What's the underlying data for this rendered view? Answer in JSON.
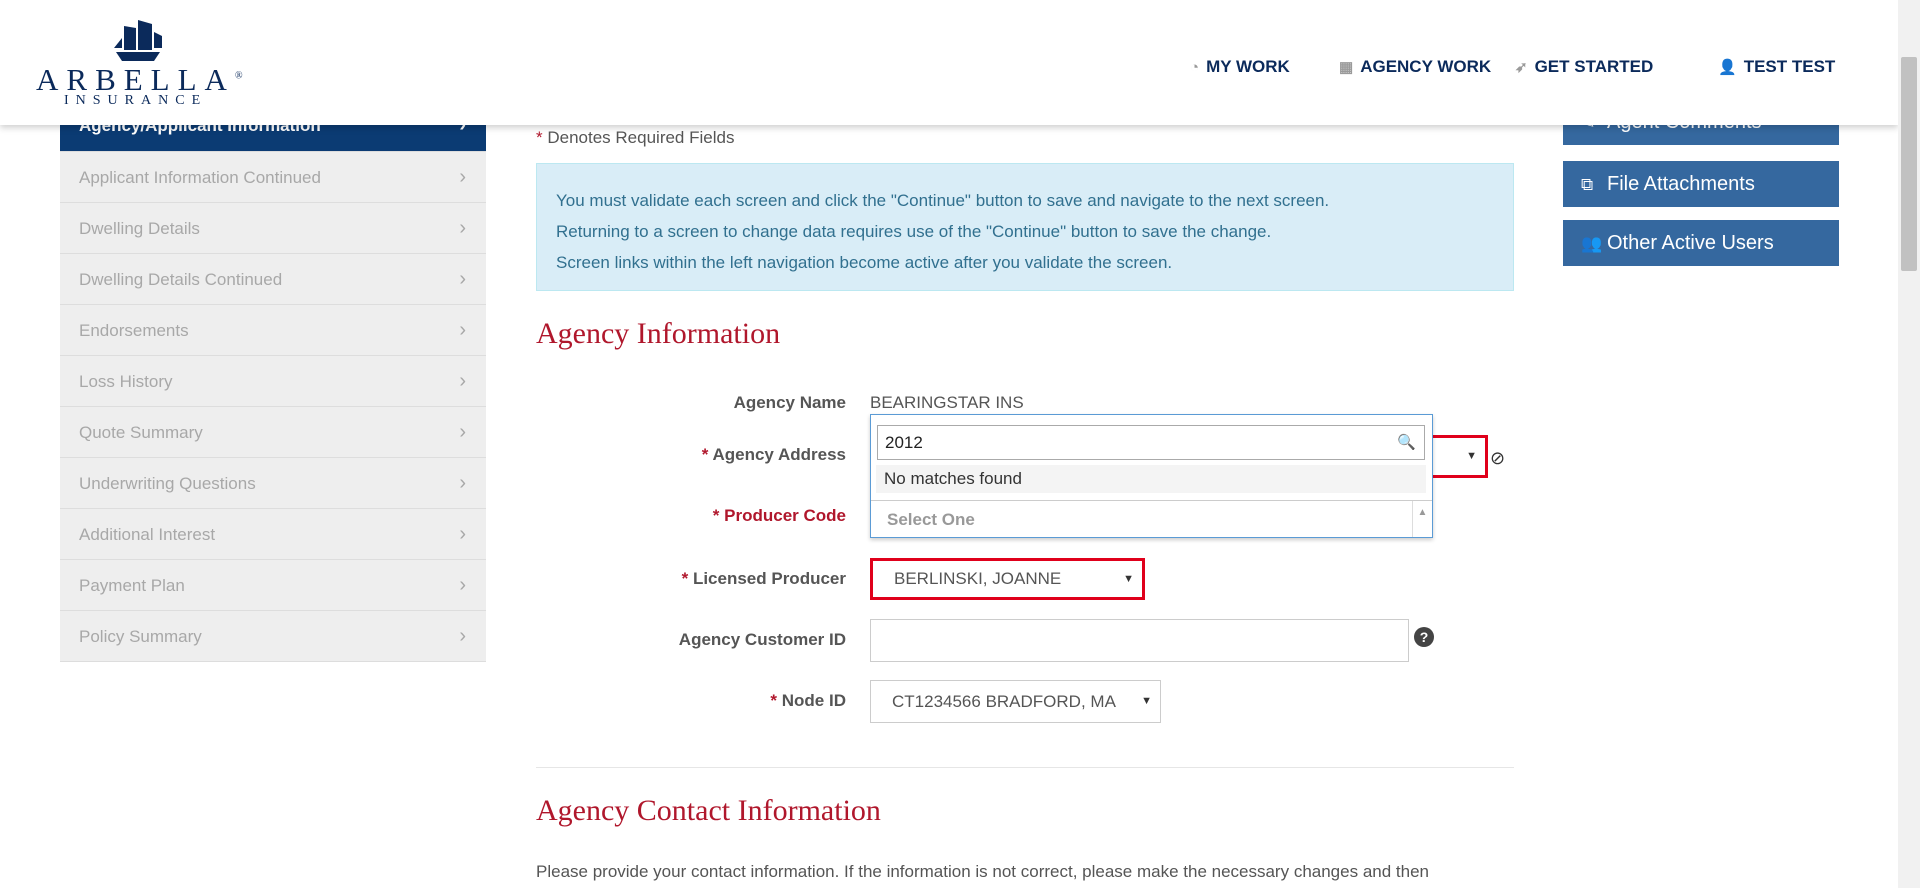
{
  "brand": {
    "name": "ARBELLA",
    "sub": "INSURANCE",
    "registered": "®"
  },
  "nav": {
    "my_work": "MY WORK",
    "agency_work": "AGENCY WORK",
    "get_started": "GET STARTED",
    "user": "TEST TEST"
  },
  "sidebar": {
    "items": [
      {
        "label": "Agency/Applicant Information"
      },
      {
        "label": "Applicant Information Continued"
      },
      {
        "label": "Dwelling Details"
      },
      {
        "label": "Dwelling Details Continued"
      },
      {
        "label": "Endorsements"
      },
      {
        "label": "Loss History"
      },
      {
        "label": "Quote Summary"
      },
      {
        "label": "Underwriting Questions"
      },
      {
        "label": "Additional Interest"
      },
      {
        "label": "Payment Plan"
      },
      {
        "label": "Policy Summary"
      }
    ]
  },
  "right_buttons": {
    "agent_comments": "Agent Comments",
    "file_attachments": "File Attachments",
    "other_active_users": "Other Active Users"
  },
  "main": {
    "required_star": "*",
    "required_note": "Denotes Required Fields",
    "info": [
      "You must validate each screen and click the \"Continue\" button to save and navigate to the next screen.",
      "Returning to a screen to change data requires use of the \"Continue\" button to save the change.",
      "Screen links within the left navigation become active after you validate the screen."
    ],
    "agency_section_title": "Agency Information",
    "fields": {
      "agency_name_label": "Agency Name",
      "agency_name_value": "BEARINGSTAR INS",
      "agency_address_label": "Agency Address",
      "producer_code_label": "Producer Code",
      "licensed_producer_label": "Licensed Producer",
      "licensed_producer_value": "BERLINSKI, JOANNE",
      "agency_customer_id_label": "Agency Customer ID",
      "agency_customer_id_value": "",
      "node_id_label": "Node ID",
      "node_id_value": "CT1234566 BRADFORD, MA"
    },
    "dropdown": {
      "search_value": "2012",
      "no_matches": "No matches found",
      "placeholder": "Select One"
    },
    "contact_section_title": "Agency Contact Information",
    "contact_paragraph": "Please provide your contact information. If the information is not correct, please make the necessary changes and then"
  },
  "colors": {
    "brand_navy": "#0b2a5b",
    "sidebar_active": "#0b3b73",
    "button_blue": "#35689f",
    "required_red": "#b0172c",
    "error_border": "#e0001b",
    "info_bg": "#d9edf7"
  }
}
